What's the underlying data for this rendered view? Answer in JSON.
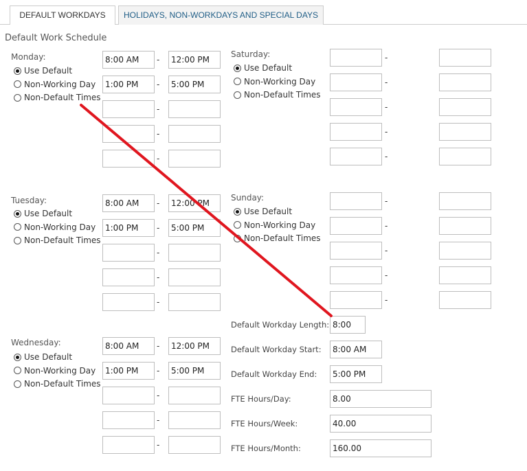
{
  "tabs": [
    {
      "label": "DEFAULT WORKDAYS",
      "active": true
    },
    {
      "label": "HOLIDAYS, NON-WORKDAYS AND SPECIAL DAYS",
      "active": false
    }
  ],
  "section_title": "Default Work Schedule",
  "radio_options": [
    "Use Default",
    "Non-Working Day",
    "Non-Default Times"
  ],
  "days": {
    "monday": {
      "label": "Monday:",
      "selected": "Use Default",
      "times": [
        [
          "8:00 AM",
          "12:00 PM"
        ],
        [
          "1:00 PM",
          "5:00 PM"
        ],
        [
          "",
          ""
        ],
        [
          "",
          ""
        ],
        [
          "",
          ""
        ]
      ]
    },
    "tuesday": {
      "label": "Tuesday:",
      "selected": "Use Default",
      "times": [
        [
          "8:00 AM",
          "12:00 PM"
        ],
        [
          "1:00 PM",
          "5:00 PM"
        ],
        [
          "",
          ""
        ],
        [
          "",
          ""
        ],
        [
          "",
          ""
        ]
      ]
    },
    "wednesday": {
      "label": "Wednesday:",
      "selected": "Use Default",
      "times": [
        [
          "8:00 AM",
          "12:00 PM"
        ],
        [
          "1:00 PM",
          "5:00 PM"
        ],
        [
          "",
          ""
        ],
        [
          "",
          ""
        ],
        [
          "",
          ""
        ]
      ]
    },
    "saturday": {
      "label": "Saturday:",
      "selected": "Use Default",
      "times": [
        [
          "",
          ""
        ],
        [
          "",
          ""
        ],
        [
          "",
          ""
        ],
        [
          "",
          ""
        ],
        [
          "",
          ""
        ]
      ]
    },
    "sunday": {
      "label": "Sunday:",
      "selected": "Use Default",
      "times": [
        [
          "",
          ""
        ],
        [
          "",
          ""
        ],
        [
          "",
          ""
        ],
        [
          "",
          ""
        ],
        [
          "",
          ""
        ]
      ]
    }
  },
  "settings": [
    {
      "label": "Default Workday Length:",
      "value": "8:00"
    },
    {
      "label": "Default Workday Start:",
      "value": "8:00 AM"
    },
    {
      "label": "Default Workday End:",
      "value": "5:00 PM"
    },
    {
      "label": "FTE Hours/Day:",
      "value": "8.00"
    },
    {
      "label": "FTE Hours/Week:",
      "value": "40.00"
    },
    {
      "label": "FTE Hours/Month:",
      "value": "160.00"
    }
  ],
  "time_separator": "-",
  "annotation_color": "#e0161f"
}
